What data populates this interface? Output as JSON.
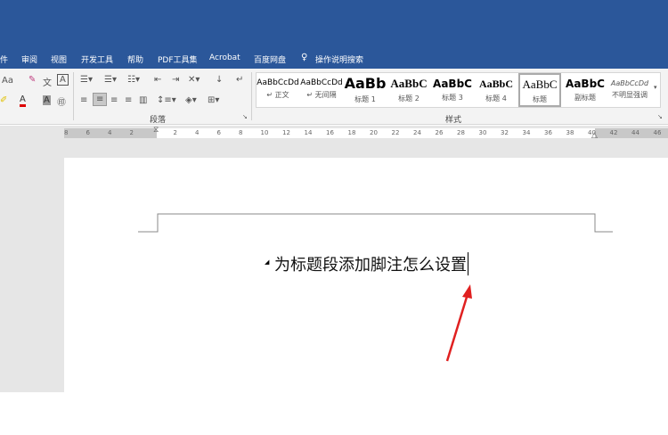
{
  "tabs": [
    "审阅",
    "视图",
    "开发工具",
    "帮助",
    "PDF工具集",
    "Acrobat",
    "百度网盘",
    "操作说明搜索"
  ],
  "partial_tab": "件",
  "ribbon": {
    "font_size_label": "Aa",
    "paragraph_group": "段落",
    "styles_group": "样式",
    "styles": [
      {
        "preview": "AaBbCcDd",
        "label": "↵ 正文"
      },
      {
        "preview": "AaBbCcDd",
        "label": "↵ 无间隔"
      },
      {
        "preview": "AaBb",
        "label": "标题 1"
      },
      {
        "preview": "AaBbC",
        "label": "标题 2"
      },
      {
        "preview": "AaBbC",
        "label": "标题 3"
      },
      {
        "preview": "AaBbC",
        "label": "标题 4"
      },
      {
        "preview": "AaBbC",
        "label": "标题"
      },
      {
        "preview": "AaBbC",
        "label": "副标题"
      },
      {
        "preview": "AaBbCcDd",
        "label": "不明显强调"
      }
    ]
  },
  "ruler": [
    "8",
    "6",
    "4",
    "2",
    "",
    "2",
    "4",
    "6",
    "8",
    "10",
    "12",
    "14",
    "16",
    "18",
    "20",
    "22",
    "24",
    "26",
    "28",
    "30",
    "32",
    "34",
    "36",
    "38",
    "40",
    "42",
    "44",
    "46"
  ],
  "document": {
    "heading": "为标题段添加脚注怎么设置"
  },
  "colors": {
    "title_bar": "#2b579a",
    "arrow": "#e02020"
  }
}
